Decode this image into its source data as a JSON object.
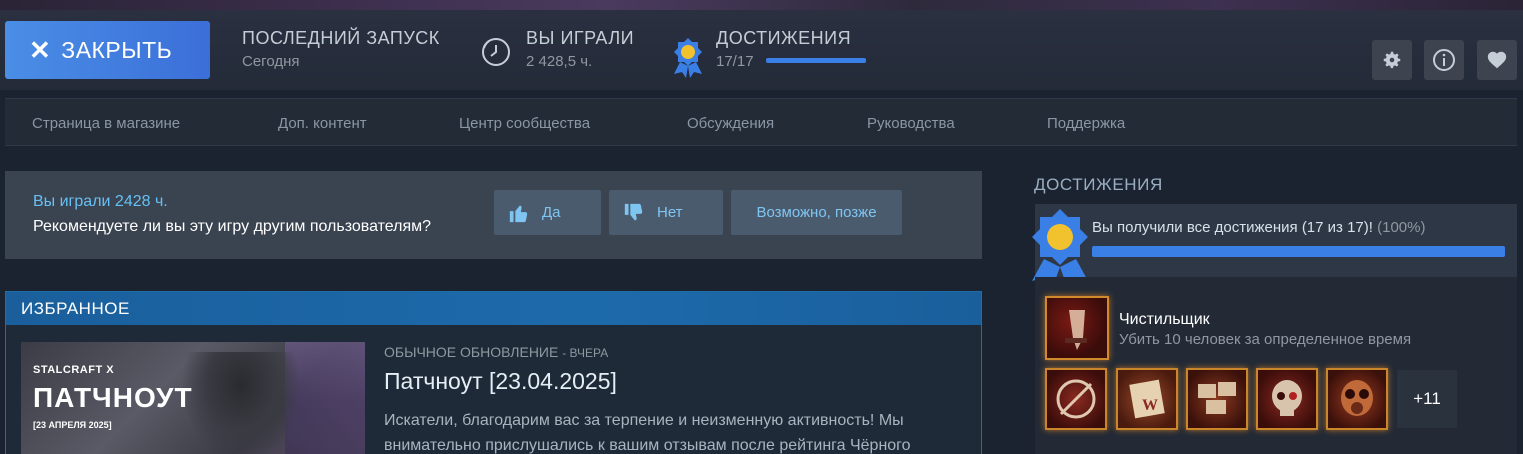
{
  "topbar": {
    "close_label": "ЗАКРЫТЬ",
    "last_launch": {
      "label": "ПОСЛЕДНИЙ ЗАПУСК",
      "value": "Сегодня"
    },
    "played": {
      "label": "ВЫ ИГРАЛИ",
      "value": "2 428,5 ч."
    },
    "achievements": {
      "label": "ДОСТИЖЕНИЯ",
      "value": "17/17",
      "progress": 1.0
    },
    "icons": [
      "gear-icon",
      "info-icon",
      "heart-icon"
    ]
  },
  "subnav": {
    "items": [
      "Страница в магазине",
      "Доп. контент",
      "Центр сообщества",
      "Обсуждения",
      "Руководства",
      "Поддержка"
    ]
  },
  "review": {
    "played_prefix": "Вы играли",
    "played_hours": "2428 ч.",
    "question": "Рекомендуете ли вы эту игру другим пользователям?",
    "yes": "Да",
    "no": "Нет",
    "later": "Возможно, позже"
  },
  "featured": {
    "header": "ИЗБРАННОЕ",
    "image": {
      "brand": "STALCRAFT X",
      "title": "ПАТЧНОУТ",
      "date": "[23 АПРЕЛЯ 2025]"
    },
    "category": "ОБЫЧНОЕ ОБНОВЛЕНИЕ",
    "when": "- ВЧЕРА",
    "title": "Патчноут [23.04.2025]",
    "desc": "Искатели, благодарим вас за терпение и неизменную активность! Мы внимательно прислушались к вашим отзывам после рейтинга Чёрного"
  },
  "achievements_panel": {
    "title": "ДОСТИЖЕНИЯ",
    "summary": "Вы получили все достижения (17 из 17)!",
    "percent": "(100%)",
    "progress": 1.0,
    "highlight": {
      "name": "Чистильщик",
      "desc": "Убить 10 человек за определенное время"
    },
    "thumbs": [
      "knife-cross-icon",
      "paper-w-icon",
      "photos-icon",
      "skull-icon",
      "gasmask-icon"
    ],
    "more": "+11"
  }
}
